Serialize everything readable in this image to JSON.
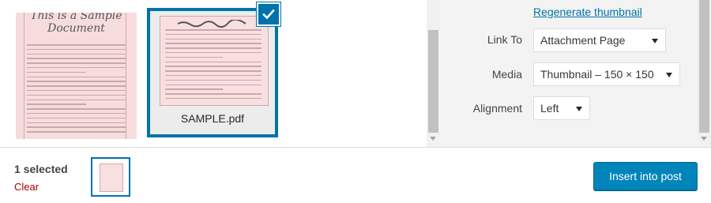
{
  "attachments": [
    {
      "title_line1": "This is a Sample",
      "title_line2": "Document",
      "selected": false
    },
    {
      "filename": "SAMPLE.pdf",
      "selected": true
    }
  ],
  "details": {
    "regenerate_link": "Regenerate thumbnail",
    "link_to": {
      "label": "Link To",
      "value": "Attachment Page"
    },
    "media": {
      "label": "Media",
      "value": "Thumbnail – 150 × 150"
    },
    "alignment": {
      "label": "Alignment",
      "value": "Left"
    }
  },
  "toolbar": {
    "selected_count": "1 selected",
    "clear_label": "Clear",
    "insert_label": "Insert into post"
  },
  "colors": {
    "accent": "#0073aa",
    "button": "#0085ba",
    "danger": "#a00000",
    "doc_bg": "#f8dfe0"
  }
}
